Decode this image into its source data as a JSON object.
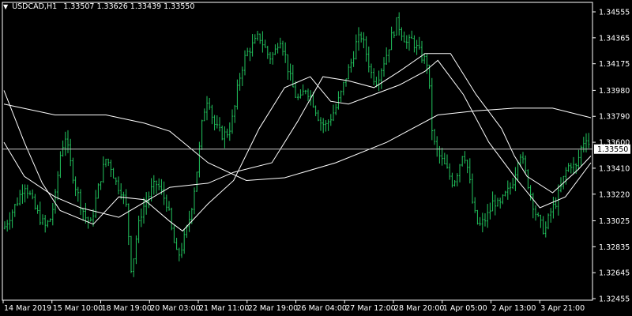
{
  "header": {
    "symbol_timeframe": "USDCAD,H1",
    "ohlc": "1.33507 1.33626 1.33439 1.33550"
  },
  "colors": {
    "background": "#000000",
    "bars": "#22c55e",
    "moving_averages": "#ffffff",
    "axis": "#ffffff",
    "price_line": "#c8c8c8",
    "current_price_bg": "#ffffff"
  },
  "chart_data": {
    "type": "line",
    "grid": false,
    "price_axis_ticks": [
      "1.34555",
      "1.34365",
      "1.34175",
      "1.33980",
      "1.33790",
      "1.33600",
      "1.33410",
      "1.33220",
      "1.33025",
      "1.32835",
      "1.32645",
      "1.32455"
    ],
    "price_axis_values": [
      1.34555,
      1.34365,
      1.34175,
      1.3398,
      1.3379,
      1.336,
      1.3341,
      1.3322,
      1.33025,
      1.32835,
      1.32645,
      1.32455
    ],
    "time_axis_ticks": [
      "14 Mar 2019",
      "15 Mar 10:00",
      "18 Mar 19:00",
      "20 Mar 03:00",
      "21 Mar 11:00",
      "22 Mar 19:00",
      "26 Mar 04:00",
      "27 Mar 12:00",
      "28 Mar 20:00",
      "1 Apr 05:00",
      "2 Apr 13:00",
      "3 Apr 21:00"
    ],
    "current_price": "1.33550",
    "current_price_value": 1.3355,
    "ylim": [
      1.32455,
      1.34555
    ],
    "price_path": [
      [
        0,
        1.3297
      ],
      [
        2,
        1.3305
      ],
      [
        4,
        1.3312
      ],
      [
        6,
        1.332
      ],
      [
        8,
        1.333
      ],
      [
        10,
        1.3322
      ],
      [
        12,
        1.3312
      ],
      [
        14,
        1.3305
      ],
      [
        16,
        1.3298
      ],
      [
        18,
        1.3303
      ],
      [
        20,
        1.3318
      ],
      [
        22,
        1.335
      ],
      [
        24,
        1.3365
      ],
      [
        26,
        1.3345
      ],
      [
        28,
        1.3328
      ],
      [
        30,
        1.3315
      ],
      [
        32,
        1.3305
      ],
      [
        34,
        1.33
      ],
      [
        36,
        1.3318
      ],
      [
        38,
        1.3335
      ],
      [
        40,
        1.3348
      ],
      [
        42,
        1.3342
      ],
      [
        44,
        1.333
      ],
      [
        46,
        1.3325
      ],
      [
        48,
        1.3312
      ],
      [
        50,
        1.3265
      ],
      [
        52,
        1.3292
      ],
      [
        54,
        1.331
      ],
      [
        56,
        1.3318
      ],
      [
        58,
        1.3326
      ],
      [
        60,
        1.333
      ],
      [
        62,
        1.3322
      ],
      [
        64,
        1.3315
      ],
      [
        66,
        1.3292
      ],
      [
        68,
        1.3275
      ],
      [
        70,
        1.3285
      ],
      [
        72,
        1.3298
      ],
      [
        74,
        1.3318
      ],
      [
        76,
        1.3345
      ],
      [
        78,
        1.338
      ],
      [
        80,
        1.3395
      ],
      [
        82,
        1.3375
      ],
      [
        84,
        1.3368
      ],
      [
        86,
        1.3365
      ],
      [
        88,
        1.3368
      ],
      [
        90,
        1.338
      ],
      [
        92,
        1.3405
      ],
      [
        94,
        1.342
      ],
      [
        96,
        1.3428
      ],
      [
        98,
        1.3432
      ],
      [
        100,
        1.3438
      ],
      [
        102,
        1.343
      ],
      [
        104,
        1.3422
      ],
      [
        106,
        1.3425
      ],
      [
        108,
        1.3438
      ],
      [
        110,
        1.3425
      ],
      [
        112,
        1.3408
      ],
      [
        114,
        1.3395
      ],
      [
        116,
        1.339
      ],
      [
        118,
        1.34
      ],
      [
        120,
        1.3395
      ],
      [
        122,
        1.3385
      ],
      [
        124,
        1.3375
      ],
      [
        126,
        1.3372
      ],
      [
        128,
        1.3378
      ],
      [
        130,
        1.3385
      ],
      [
        132,
        1.3395
      ],
      [
        134,
        1.3408
      ],
      [
        136,
        1.3418
      ],
      [
        138,
        1.3432
      ],
      [
        140,
        1.3438
      ],
      [
        142,
        1.3425
      ],
      [
        144,
        1.341
      ],
      [
        146,
        1.3405
      ],
      [
        148,
        1.3415
      ],
      [
        150,
        1.3425
      ],
      [
        152,
        1.3438
      ],
      [
        154,
        1.3448
      ],
      [
        156,
        1.344
      ],
      [
        158,
        1.3432
      ],
      [
        160,
        1.3435
      ],
      [
        162,
        1.3428
      ],
      [
        164,
        1.3422
      ],
      [
        166,
        1.3418
      ],
      [
        168,
        1.3362
      ],
      [
        170,
        1.3352
      ],
      [
        172,
        1.3345
      ],
      [
        174,
        1.3338
      ],
      [
        176,
        1.333
      ],
      [
        178,
        1.334
      ],
      [
        180,
        1.3355
      ],
      [
        182,
        1.3338
      ],
      [
        184,
        1.331
      ],
      [
        186,
        1.3298
      ],
      [
        188,
        1.3302
      ],
      [
        190,
        1.3308
      ],
      [
        192,
        1.3318
      ],
      [
        194,
        1.3312
      ],
      [
        196,
        1.332
      ],
      [
        198,
        1.3325
      ],
      [
        200,
        1.3335
      ],
      [
        202,
        1.3355
      ],
      [
        204,
        1.334
      ],
      [
        206,
        1.3325
      ],
      [
        208,
        1.331
      ],
      [
        210,
        1.33
      ],
      [
        212,
        1.3295
      ],
      [
        214,
        1.3308
      ],
      [
        216,
        1.3315
      ],
      [
        218,
        1.3325
      ],
      [
        220,
        1.3338
      ],
      [
        222,
        1.3345
      ],
      [
        224,
        1.334
      ],
      [
        226,
        1.3355
      ],
      [
        228,
        1.3365
      ],
      [
        230,
        1.3355
      ]
    ],
    "series": [
      {
        "values": [
          [
            0,
            1.3388
          ],
          [
            20,
            1.338
          ],
          [
            40,
            1.338
          ],
          [
            55,
            1.3374
          ],
          [
            65,
            1.3368
          ],
          [
            80,
            1.3345
          ],
          [
            95,
            1.3332
          ],
          [
            110,
            1.3334
          ],
          [
            130,
            1.3345
          ],
          [
            150,
            1.336
          ],
          [
            170,
            1.338
          ],
          [
            185,
            1.3383
          ],
          [
            200,
            1.3385
          ],
          [
            215,
            1.3385
          ],
          [
            230,
            1.3378
          ]
        ]
      },
      {
        "values": [
          [
            0,
            1.336
          ],
          [
            8,
            1.3335
          ],
          [
            20,
            1.332
          ],
          [
            30,
            1.3312
          ],
          [
            45,
            1.3305
          ],
          [
            55,
            1.3316
          ],
          [
            65,
            1.3327
          ],
          [
            80,
            1.333
          ],
          [
            90,
            1.3338
          ],
          [
            105,
            1.3345
          ],
          [
            115,
            1.3375
          ],
          [
            125,
            1.3408
          ],
          [
            135,
            1.3405
          ],
          [
            145,
            1.34
          ],
          [
            155,
            1.3412
          ],
          [
            165,
            1.3425
          ],
          [
            175,
            1.3425
          ],
          [
            185,
            1.3395
          ],
          [
            195,
            1.337
          ],
          [
            200,
            1.335
          ],
          [
            205,
            1.3335
          ],
          [
            215,
            1.3323
          ],
          [
            225,
            1.334
          ],
          [
            230,
            1.335
          ]
        ]
      },
      {
        "values": [
          [
            0,
            1.3398
          ],
          [
            8,
            1.336
          ],
          [
            15,
            1.333
          ],
          [
            22,
            1.331
          ],
          [
            35,
            1.33
          ],
          [
            45,
            1.332
          ],
          [
            55,
            1.3318
          ],
          [
            65,
            1.3302
          ],
          [
            70,
            1.3295
          ],
          [
            80,
            1.3315
          ],
          [
            90,
            1.3332
          ],
          [
            100,
            1.337
          ],
          [
            110,
            1.34
          ],
          [
            120,
            1.3408
          ],
          [
            128,
            1.339
          ],
          [
            135,
            1.3388
          ],
          [
            145,
            1.3395
          ],
          [
            155,
            1.3402
          ],
          [
            165,
            1.3412
          ],
          [
            170,
            1.342
          ],
          [
            180,
            1.3395
          ],
          [
            190,
            1.336
          ],
          [
            200,
            1.3335
          ],
          [
            210,
            1.3312
          ],
          [
            220,
            1.332
          ],
          [
            230,
            1.3345
          ]
        ]
      }
    ]
  }
}
